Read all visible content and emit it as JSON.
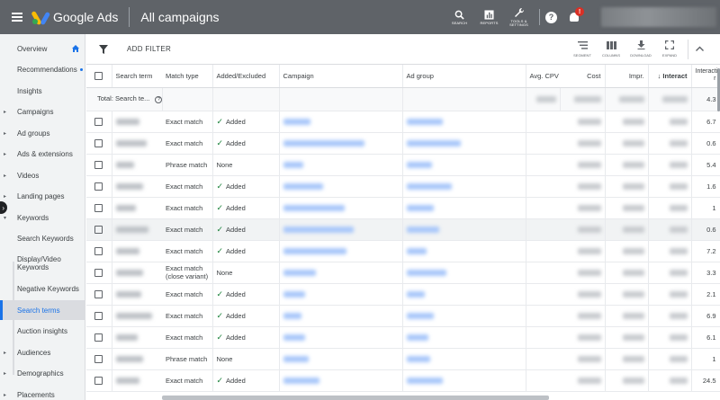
{
  "header": {
    "logo_text": "Google Ads",
    "page_title": "All campaigns",
    "tools": [
      {
        "label": "SEARCH",
        "icon": "search-icon"
      },
      {
        "label": "REPORTS",
        "icon": "reports-icon"
      },
      {
        "label": "TOOLS &\nSETTINGS",
        "icon": "wrench-icon"
      }
    ],
    "help_glyph": "?",
    "notification_badge": "!"
  },
  "sidebar": {
    "items": [
      {
        "label": "Overview",
        "kind": "top"
      },
      {
        "label": "Recommendations",
        "kind": "top"
      },
      {
        "label": "Insights",
        "kind": "top"
      },
      {
        "label": "Campaigns",
        "kind": "expandable"
      },
      {
        "label": "Ad groups",
        "kind": "expandable"
      },
      {
        "label": "Ads & extensions",
        "kind": "expandable"
      },
      {
        "label": "Videos",
        "kind": "expandable"
      },
      {
        "label": "Landing pages",
        "kind": "expandable"
      },
      {
        "label": "Keywords",
        "kind": "expandable"
      },
      {
        "label": "Search Keywords",
        "kind": "sub"
      },
      {
        "label": "Display/Video Keywords",
        "kind": "sub"
      },
      {
        "label": "Negative Keywords",
        "kind": "sub"
      },
      {
        "label": "Search terms",
        "kind": "sub-active"
      },
      {
        "label": "Auction insights",
        "kind": "sub"
      },
      {
        "label": "Audiences",
        "kind": "expandable"
      },
      {
        "label": "Demographics",
        "kind": "expandable"
      },
      {
        "label": "Placements",
        "kind": "expandable"
      }
    ]
  },
  "toolbar": {
    "add_filter": "ADD FILTER",
    "tools": [
      {
        "label": "SEGMENT",
        "icon": "segment-icon"
      },
      {
        "label": "COLUMNS",
        "icon": "columns-icon"
      },
      {
        "label": "DOWNLOAD",
        "icon": "download-icon"
      },
      {
        "label": "EXPAND",
        "icon": "expand-icon"
      }
    ]
  },
  "table": {
    "headers": {
      "search_term": "Search term",
      "match_type": "Match type",
      "added_excluded": "Added/Excluded",
      "campaign": "Campaign",
      "ad_group": "Ad group",
      "avg_cpv": "Avg. CPV",
      "cost": "Cost",
      "impr": "Impr.",
      "interactions": "Interact",
      "interaction_rate": "Interactio r"
    },
    "total_label": "Total: Search te...",
    "total_last": "4.3",
    "rows": [
      {
        "match": "Exact match",
        "status": "Added",
        "added": true,
        "last": "6.7"
      },
      {
        "match": "Exact match",
        "status": "Added",
        "added": true,
        "last": "0.6"
      },
      {
        "match": "Phrase match",
        "status": "None",
        "added": false,
        "last": "5.4"
      },
      {
        "match": "Exact match",
        "status": "Added",
        "added": true,
        "last": "1.6"
      },
      {
        "match": "Exact match",
        "status": "Added",
        "added": true,
        "last": "1"
      },
      {
        "match": "Exact match",
        "status": "Added",
        "added": true,
        "last": "0.6"
      },
      {
        "match": "Exact match",
        "status": "Added",
        "added": true,
        "last": "7.2"
      },
      {
        "match": "Exact match (close variant)",
        "status": "None",
        "added": false,
        "last": "3.3"
      },
      {
        "match": "Exact match",
        "status": "Added",
        "added": true,
        "last": "2.1"
      },
      {
        "match": "Exact match",
        "status": "Added",
        "added": true,
        "last": "6.9"
      },
      {
        "match": "Exact match",
        "status": "Added",
        "added": true,
        "last": "6.1"
      },
      {
        "match": "Phrase match",
        "status": "None",
        "added": false,
        "last": "1"
      },
      {
        "match": "Exact match",
        "status": "Added",
        "added": true,
        "last": "24.5"
      }
    ]
  },
  "colors": {
    "topbar": "#5f6368",
    "accent": "#1a73e8",
    "added_check": "#188038",
    "notification": "#d93025"
  }
}
